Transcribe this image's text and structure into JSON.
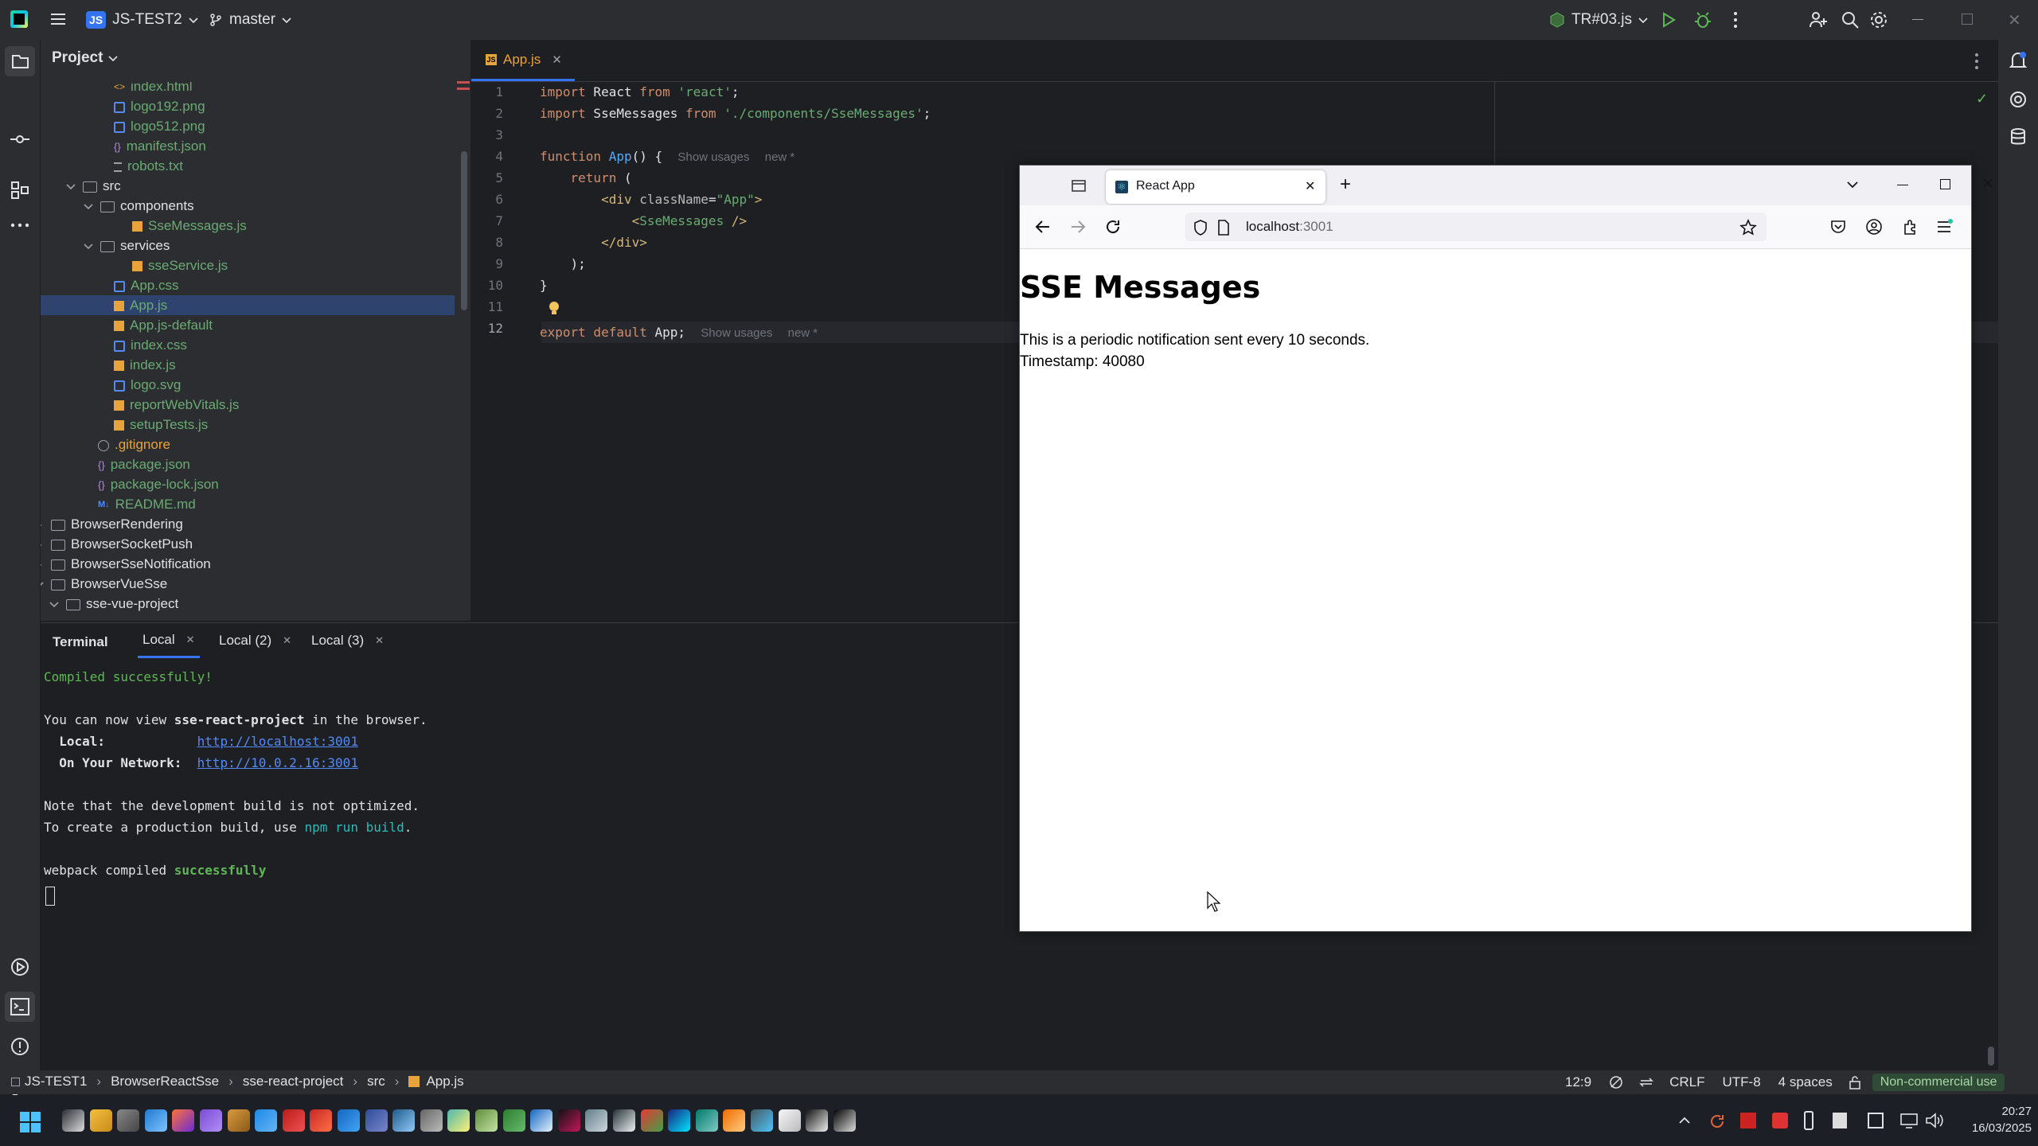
{
  "titlebar": {
    "project_badge": "JS",
    "project_name": "JS-TEST2",
    "branch": "master",
    "run_config": "TR#03.js"
  },
  "project_panel": {
    "title": "Project",
    "tree": [
      {
        "label": "index.html",
        "kind": "html",
        "color": "green"
      },
      {
        "label": "logo192.png",
        "kind": "img",
        "color": "green"
      },
      {
        "label": "logo512.png",
        "kind": "img",
        "color": "green"
      },
      {
        "label": "manifest.json",
        "kind": "json",
        "color": "green"
      },
      {
        "label": "robots.txt",
        "kind": "txt",
        "color": "green"
      },
      {
        "label": "src",
        "kind": "folder",
        "color": "fold"
      },
      {
        "label": "components",
        "kind": "folder",
        "color": "fold"
      },
      {
        "label": "SseMessages.js",
        "kind": "js",
        "color": "green"
      },
      {
        "label": "services",
        "kind": "folder",
        "color": "fold"
      },
      {
        "label": "sseService.js",
        "kind": "js",
        "color": "green"
      },
      {
        "label": "App.css",
        "kind": "css",
        "color": "green"
      },
      {
        "label": "App.js",
        "kind": "js",
        "color": "green"
      },
      {
        "label": "App.js-default",
        "kind": "js",
        "color": "green"
      },
      {
        "label": "index.css",
        "kind": "css",
        "color": "green"
      },
      {
        "label": "index.js",
        "kind": "js",
        "color": "green"
      },
      {
        "label": "logo.svg",
        "kind": "img",
        "color": "green"
      },
      {
        "label": "reportWebVitals.js",
        "kind": "js",
        "color": "green"
      },
      {
        "label": "setupTests.js",
        "kind": "js",
        "color": "green"
      },
      {
        "label": ".gitignore",
        "kind": "ignore",
        "color": "orange"
      },
      {
        "label": "package.json",
        "kind": "json",
        "color": "green"
      },
      {
        "label": "package-lock.json",
        "kind": "json",
        "color": "green"
      },
      {
        "label": "README.md",
        "kind": "md",
        "color": "green"
      },
      {
        "label": "BrowserRendering",
        "kind": "folder",
        "color": "fold"
      },
      {
        "label": "BrowserSocketPush",
        "kind": "folder",
        "color": "fold"
      },
      {
        "label": "BrowserSseNotification",
        "kind": "folder",
        "color": "fold"
      },
      {
        "label": "BrowserVueSse",
        "kind": "folder",
        "color": "fold"
      },
      {
        "label": "sse-vue-project",
        "kind": "folder",
        "color": "fold"
      }
    ]
  },
  "editor": {
    "tab_label": "App.js",
    "line_numbers": [
      "1",
      "2",
      "3",
      "4",
      "5",
      "6",
      "7",
      "8",
      "9",
      "10",
      "11",
      "12"
    ],
    "hint_show_usages": "Show usages",
    "hint_new": "new *"
  },
  "terminal": {
    "title": "Terminal",
    "tabs": [
      "Local",
      "Local (2)",
      "Local (3)"
    ],
    "lines": {
      "compiled": "Compiled successfully!",
      "view_prefix": "You can now view ",
      "project": "sse-react-project",
      "view_suffix": " in the browser.",
      "local_label": "  Local:            ",
      "local_url": "http://localhost:3001",
      "network_label": "  On Your Network:  ",
      "network_url": "http://10.0.2.16:3001",
      "note1": "Note that the development build is not optimized.",
      "note2_prefix": "To create a production build, use ",
      "note2_cmd": "npm run build",
      "note2_suffix": ".",
      "webpack_prefix": "webpack compiled ",
      "webpack_success": "successfully"
    }
  },
  "browser": {
    "tab_title": "React App",
    "url_host": "localhost",
    "url_port": ":3001",
    "heading": "SSE Messages",
    "message": "This is a periodic notification sent every 10 seconds.",
    "timestamp": "Timestamp: 40080"
  },
  "statusbar": {
    "crumbs": [
      "JS-TEST1",
      "BrowserReactSse",
      "sse-react-project",
      "src",
      "App.js"
    ],
    "position": "12:9",
    "line_ending": "CRLF",
    "encoding": "UTF-8",
    "indent": "4 spaces",
    "license": "Non-commercial use"
  },
  "taskbar": {
    "time": "20:27",
    "date": "16/03/2025"
  },
  "colors": {
    "accent": "#3574f0",
    "ide_bg": "#1e1f22",
    "panel_bg": "#2b2d30"
  }
}
